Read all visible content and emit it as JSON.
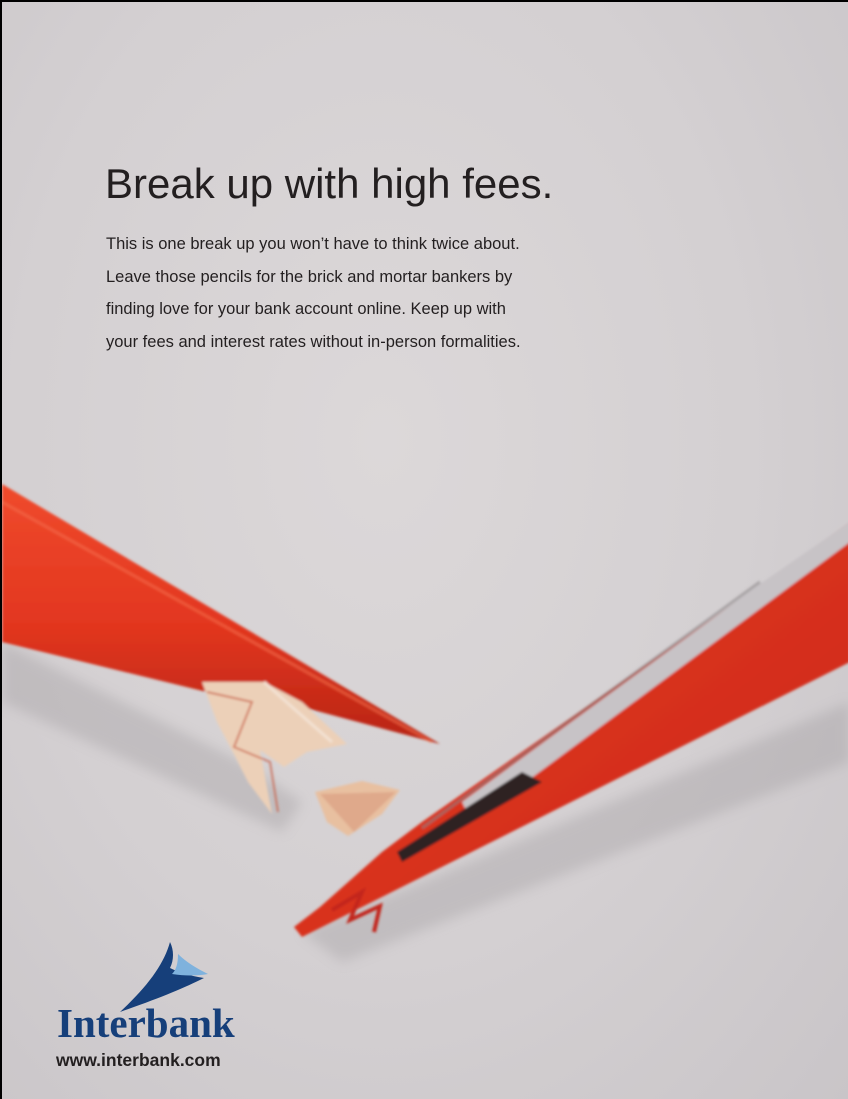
{
  "ad": {
    "headline": "Break up with high fees.",
    "body_lines": [
      "This is one break up you won’t have to think twice about.",
      "Leave those pencils for the brick and mortar bankers by",
      "finding love for your bank account online. Keep up with",
      "your fees and interest rates without in-person formalities."
    ]
  },
  "image": {
    "subject": "broken-red-pencil",
    "pencil_color": "#e2361f",
    "wood_color": "#e9c9ae"
  },
  "brand": {
    "name": "Interbank",
    "url": "www.interbank.com",
    "logo_icon": "interbank-swoosh-icon",
    "navy": "#163f7a",
    "light_blue": "#7fb2dd"
  }
}
